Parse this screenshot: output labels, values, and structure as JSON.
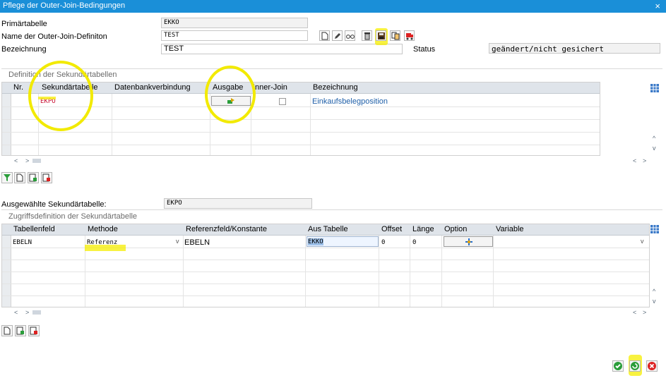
{
  "window": {
    "title": "Pflege der Outer-Join-Bedingungen",
    "close": "×"
  },
  "header": {
    "primaertabelle_label": "Primärtabelle",
    "primaertabelle_value": "EKKO",
    "name_label": "Name der Outer-Join-Definiton",
    "name_value": "TEST",
    "bezeichnung_label": "Bezeichnung",
    "bezeichnung_value": "TEST",
    "status_label": "Status",
    "status_value": "geändert/nicht gesichert"
  },
  "secondary": {
    "group_title": "Definition der Sekundärtabellen",
    "columns": [
      "Nr.",
      "Sekundärtabelle",
      "Datenbankverbindung",
      "Ausgabe",
      "Inner-Join",
      "Bezeichnung"
    ],
    "rows": [
      {
        "nr": "",
        "sekundaertabelle": "EKPO",
        "datenbankverbindung": "",
        "bezeichnung": "Einkaufsbelegposition"
      }
    ]
  },
  "selected": {
    "label": "Ausgewählte Sekundärtabelle:",
    "value": "EKPO"
  },
  "access": {
    "group_title": "Zugriffsdefinition der Sekundärtabelle",
    "columns": [
      "Tabellenfeld",
      "Methode",
      "Referenzfeld/Konstante",
      "Aus Tabelle",
      "Offset",
      "Länge",
      "Option",
      "Variable"
    ],
    "rows": [
      {
        "tabellenfeld": "EBELN",
        "methode": "Referenz",
        "referenzfeld": "EBELN",
        "aus_tabelle": "EKKO",
        "offset": "0",
        "laenge": "0",
        "variable": ""
      }
    ]
  },
  "scroll": {
    "left": "<",
    "right": ">",
    "up": "^",
    "down": "v"
  },
  "colors": {
    "titlebar": "#1a8fd8",
    "highlight": "#f2ea00",
    "link": "#1f5fa8",
    "red_text": "#c8102e"
  },
  "icons": [
    "new-document-icon",
    "pencil-icon",
    "display-glasses-icon",
    "trash-icon",
    "save-icon",
    "copy-icon",
    "transport-icon",
    "grid-settings-icon",
    "output-icon",
    "checkbox-icon",
    "option-icon",
    "confirm-icon",
    "reset-icon",
    "cancel-icon"
  ]
}
